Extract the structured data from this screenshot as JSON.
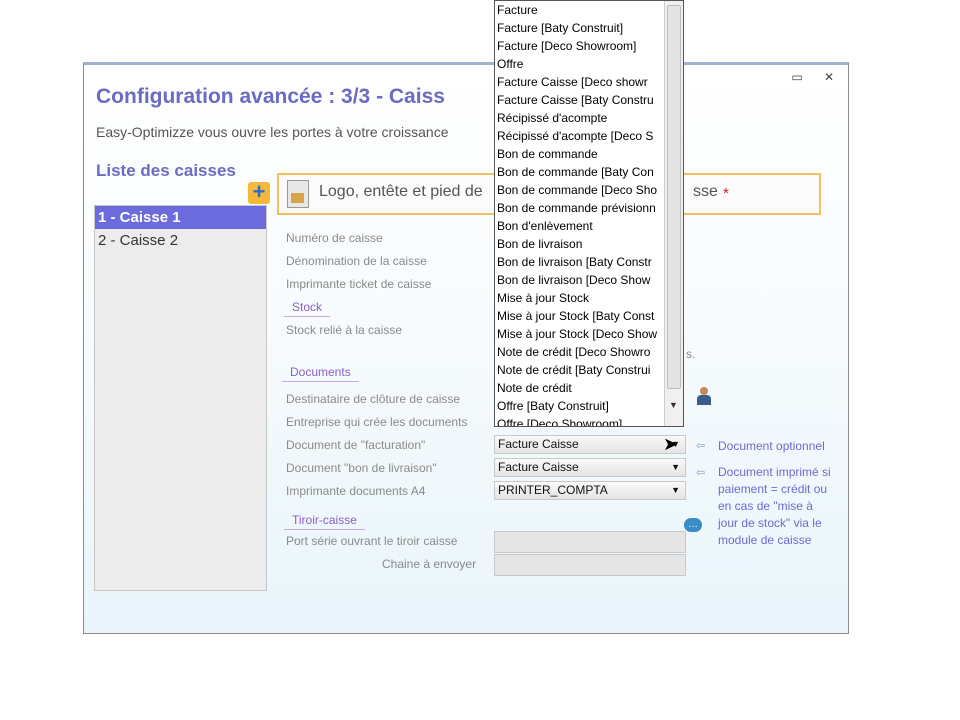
{
  "window": {
    "title": "Configuration avancée  : 3/3  -  Caiss",
    "subtitle": "Easy-Optimizze vous ouvre les portes à votre croissance",
    "minimize_label": "▭",
    "close_label": "✕"
  },
  "sidebar": {
    "title": "Liste des caisses",
    "add_label": "+",
    "items": [
      {
        "label": "1 - Caisse 1",
        "selected": true
      },
      {
        "label": "2 - Caisse 2",
        "selected": false
      }
    ]
  },
  "logo_box": {
    "text": "Logo, entête et pied de",
    "text_tail": "sse",
    "required_mark": "*"
  },
  "form": {
    "numero_caisse": "Numéro de caisse",
    "denomination": "Dénomination de la caisse",
    "imprimante_ticket": "Imprimante ticket de caisse",
    "stock_group": "Stock",
    "stock_relie": "Stock relié à la caisse",
    "documents_group": "Documents",
    "destinataire": "Destinataire de clôture de caisse",
    "entreprise": "Entreprise qui crée les documents",
    "doc_facturation": "Document de \"facturation\"",
    "doc_bon_livraison": "Document \"bon de livraison\"",
    "imprimante_a4": "Imprimante documents A4",
    "tiroir_group": "Tiroir-caisse",
    "port_serie": "Port série ouvrant le tiroir caisse",
    "chaine": "Chaine à envoyer",
    "doc_facturation_value": "Facture Caisse",
    "doc_bon_livraison_value": "Facture Caisse",
    "imprimante_a4_value": "PRINTER_COMPTA",
    "stock_partial_text": "s."
  },
  "notes": {
    "optionnel": "Document optionnel",
    "imprime_lines": [
      "Document imprimé si",
      "paiement = crédit ou",
      "en cas de \"mise à",
      "jour de stock\" via le",
      "module de caisse"
    ]
  },
  "dropdown": {
    "items": [
      "Facture",
      "Facture [Baty Construit]",
      "Facture [Deco Showroom]",
      "Offre",
      "Facture Caisse [Deco showr",
      "Facture Caisse [Baty Constru",
      "Récipissé d'acompte",
      "Récipissé d'acompte [Deco S",
      "Bon de commande",
      "Bon de commande [Baty Con",
      "Bon de commande [Deco Sho",
      "Bon de commande prévisionn",
      "Bon d'enlèvement",
      "Bon de livraison",
      "Bon de livraison [Baty Constr",
      "Bon de livraison [Deco Show",
      "Mise à jour Stock",
      "Mise à jour Stock [Baty Const",
      "Mise à jour Stock [Deco Show",
      "Note de crédit [Deco Showro",
      "Note de crédit [Baty Construi",
      "Note de crédit",
      "Offre [Baty Construit]",
      "Offre [Deco Showroom]"
    ]
  },
  "colors": {
    "accent": "#6b6bc4",
    "selected": "#6b6bde",
    "note": "#6b6bd0"
  }
}
